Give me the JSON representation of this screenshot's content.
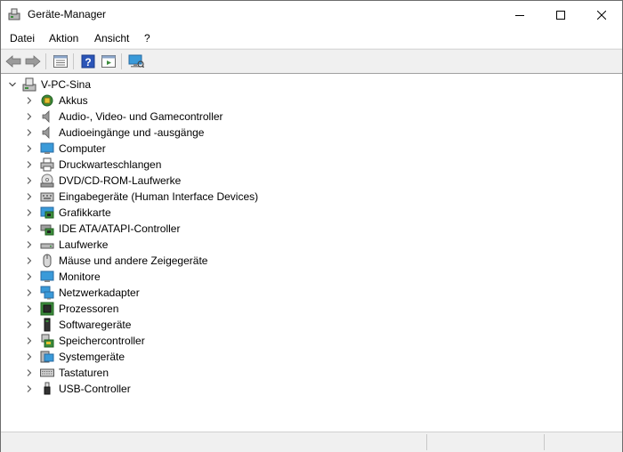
{
  "window": {
    "title": "Geräte-Manager",
    "icon": "device-manager-icon"
  },
  "menu": {
    "items": [
      {
        "label": "Datei"
      },
      {
        "label": "Aktion"
      },
      {
        "label": "Ansicht"
      },
      {
        "label": "?"
      }
    ]
  },
  "toolbar": {
    "buttons": [
      "back-arrow-icon",
      "forward-arrow-icon",
      "properties-icon",
      "help-icon",
      "run-icon",
      "scan-hardware-icon"
    ]
  },
  "tree": {
    "root": {
      "label": "V-PC-Sina",
      "icon": "computer-tower-icon",
      "expanded": true
    },
    "children": [
      {
        "label": "Akkus",
        "icon": "battery-icon"
      },
      {
        "label": "Audio-, Video- und Gamecontroller",
        "icon": "speaker-icon"
      },
      {
        "label": "Audioeingänge und -ausgänge",
        "icon": "speaker-icon"
      },
      {
        "label": "Computer",
        "icon": "monitor-icon"
      },
      {
        "label": "Druckwarteschlangen",
        "icon": "printer-icon"
      },
      {
        "label": "DVD/CD-ROM-Laufwerke",
        "icon": "disc-drive-icon"
      },
      {
        "label": "Eingabegeräte (Human Interface Devices)",
        "icon": "hid-icon"
      },
      {
        "label": "Grafikkarte",
        "icon": "graphics-card-icon"
      },
      {
        "label": "IDE ATA/ATAPI-Controller",
        "icon": "ide-controller-icon"
      },
      {
        "label": "Laufwerke",
        "icon": "drive-icon"
      },
      {
        "label": "Mäuse und andere Zeigegeräte",
        "icon": "mouse-icon"
      },
      {
        "label": "Monitore",
        "icon": "monitor-icon"
      },
      {
        "label": "Netzwerkadapter",
        "icon": "network-icon"
      },
      {
        "label": "Prozessoren",
        "icon": "processor-icon"
      },
      {
        "label": "Softwaregeräte",
        "icon": "software-device-icon"
      },
      {
        "label": "Speichercontroller",
        "icon": "storage-controller-icon"
      },
      {
        "label": "Systemgeräte",
        "icon": "system-device-icon"
      },
      {
        "label": "Tastaturen",
        "icon": "keyboard-icon"
      },
      {
        "label": "USB-Controller",
        "icon": "usb-icon"
      }
    ]
  },
  "colors": {
    "accent": "#1e78d7",
    "monitor": "#3a9ad9",
    "chip": "#3c8c3c"
  }
}
